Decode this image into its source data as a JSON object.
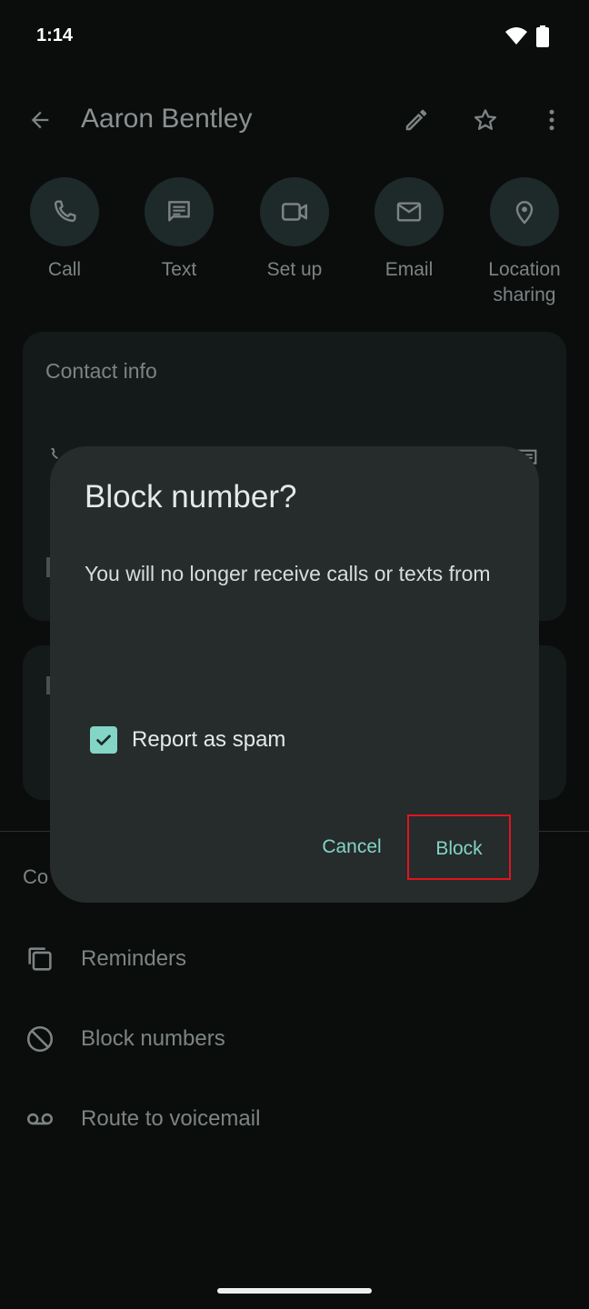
{
  "status_bar": {
    "time": "1:14",
    "icons": [
      "wifi-icon",
      "battery-icon"
    ]
  },
  "app_bar": {
    "title": "Aaron Bentley",
    "icons": [
      "back-arrow-icon",
      "edit-icon",
      "star-icon",
      "more-vert-icon"
    ]
  },
  "actions": [
    {
      "label": "Call",
      "icon": "phone-icon"
    },
    {
      "label": "Text",
      "icon": "message-icon"
    },
    {
      "label": "Set up",
      "icon": "video-icon"
    },
    {
      "label": "Email",
      "icon": "mail-icon"
    },
    {
      "label": "Location\nsharing",
      "icon": "location-pin-icon"
    }
  ],
  "contact_info_card": {
    "title": "Contact info"
  },
  "section": {
    "heading": "Co"
  },
  "list_items": [
    {
      "label": "Reminders",
      "icon": "reminders-icon"
    },
    {
      "label": "Block numbers",
      "icon": "block-icon"
    },
    {
      "label": "Route to voicemail",
      "icon": "voicemail-icon"
    }
  ],
  "dialog": {
    "title": "Block number?",
    "body": "You will no longer receive calls or texts from",
    "checkbox_label": "Report as spam",
    "checkbox_checked": true,
    "cancel_label": "Cancel",
    "block_label": "Block"
  },
  "colors": {
    "background": "#0b0d0d",
    "dialog": "#262b2b",
    "accent": "#83d5c6",
    "highlight_box": "#e0141e"
  }
}
